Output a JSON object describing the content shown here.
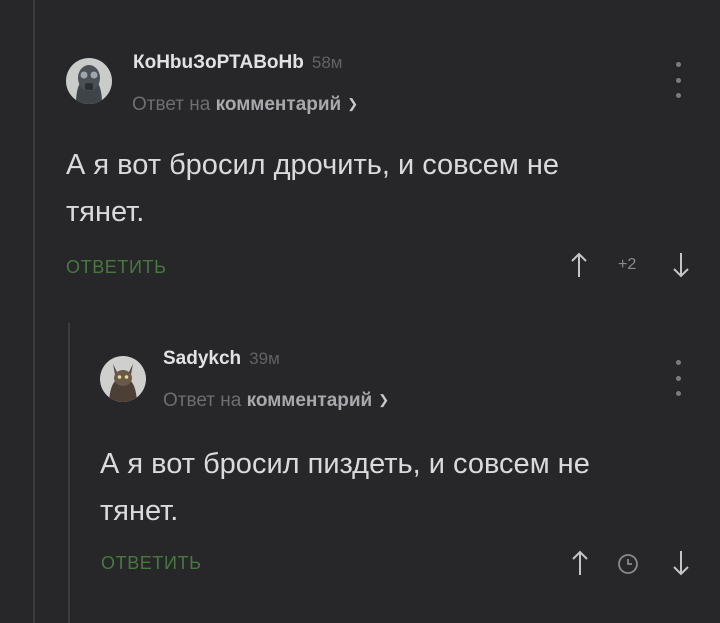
{
  "comments": [
    {
      "username": "КоНbuЗоРТАВоНb",
      "time": "58м",
      "reply_prefix": "Ответ на",
      "reply_target": "комментарий",
      "text": "А я вот бросил дрочить, и совсем не тянет.",
      "reply_label": "ОТВЕТИТЬ",
      "score": "+2",
      "avatar_icon": "gasmask-avatar"
    },
    {
      "username": "Sadykch",
      "time": "39м",
      "reply_prefix": "Ответ на",
      "reply_target": "комментарий",
      "text": "А я вот бросил пиздеть, и совсем не тянет.",
      "reply_label": "ОТВЕТИТЬ",
      "score_icon": "clock-icon",
      "avatar_icon": "cat-avatar"
    }
  ],
  "colors": {
    "background": "#27272a",
    "accent_green": "#48783f",
    "muted": "#6e6e72"
  }
}
